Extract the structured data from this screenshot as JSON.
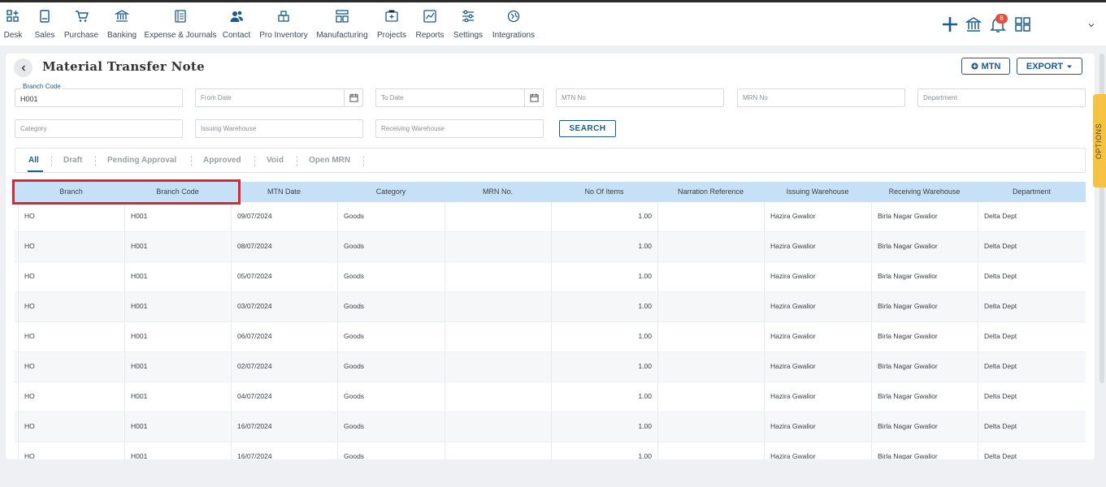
{
  "nav": [
    {
      "label": "Desk",
      "icon": "desk-icon"
    },
    {
      "label": "Sales",
      "icon": "sales-icon"
    },
    {
      "label": "Purchase",
      "icon": "purchase-icon"
    },
    {
      "label": "Banking",
      "icon": "bank-icon"
    },
    {
      "label": "Expense & Journals",
      "icon": "journal-icon"
    },
    {
      "label": "Contact",
      "icon": "contact-icon"
    },
    {
      "label": "Pro Inventory",
      "icon": "inventory-icon"
    },
    {
      "label": "Manufacturing",
      "icon": "manufacturing-icon"
    },
    {
      "label": "Projects",
      "icon": "projects-icon"
    },
    {
      "label": "Reports",
      "icon": "reports-icon"
    },
    {
      "label": "Settings",
      "icon": "settings-icon"
    },
    {
      "label": "Integrations",
      "icon": "integrations-icon"
    }
  ],
  "notification_count": "8",
  "accent": "#1a5b8f",
  "page": {
    "title": "Material Transfer Note",
    "mtn_button": "MTN",
    "export_button": "EXPORT"
  },
  "filters": {
    "branch_code_label": "Branch Code",
    "branch_code_value": "H001",
    "from_date": "From Date",
    "to_date": "To Date",
    "mtn_no": "MTN No",
    "mrn_no": "MRN No",
    "department": "Department",
    "category": "Category",
    "issuing_warehouse": "Issuing Warehouse",
    "receiving_warehouse": "Receiving Warehouse",
    "search_button": "SEARCH"
  },
  "tabs": [
    "All",
    "Draft",
    "Pending Approval",
    "Approved",
    "Void",
    "Open MRN"
  ],
  "table": {
    "columns": [
      "Branch",
      "Branch Code",
      "MTN Date",
      "Category",
      "MRN No.",
      "No Of Items",
      "Narration Reference",
      "Issuing Warehouse",
      "Receiving Warehouse",
      "Department"
    ],
    "rows": [
      [
        "HO",
        "H001",
        "09/07/2024",
        "Goods",
        "",
        "1.00",
        "",
        "Hazira Gwalior",
        "Birla Nagar Gwalior",
        "Delta Dept"
      ],
      [
        "HO",
        "H001",
        "08/07/2024",
        "Goods",
        "",
        "1.00",
        "",
        "Hazira Gwalior",
        "Birla Nagar Gwalior",
        "Delta Dept"
      ],
      [
        "HO",
        "H001",
        "05/07/2024",
        "Goods",
        "",
        "1.00",
        "",
        "Hazira Gwalior",
        "Birla Nagar Gwalior",
        "Delta Dept"
      ],
      [
        "HO",
        "H001",
        "03/07/2024",
        "Goods",
        "",
        "1.00",
        "",
        "Hazira Gwalior",
        "Birla Nagar Gwalior",
        "Delta Dept"
      ],
      [
        "HO",
        "H001",
        "06/07/2024",
        "Goods",
        "",
        "1.00",
        "",
        "Hazira Gwalior",
        "Birla Nagar Gwalior",
        "Delta Dept"
      ],
      [
        "HO",
        "H001",
        "02/07/2024",
        "Goods",
        "",
        "1.00",
        "",
        "Hazira Gwalior",
        "Birla Nagar Gwalior",
        "Delta Dept"
      ],
      [
        "HO",
        "H001",
        "04/07/2024",
        "Goods",
        "",
        "1.00",
        "",
        "Hazira Gwalior",
        "Birla Nagar Gwalior",
        "Delta Dept"
      ],
      [
        "HO",
        "H001",
        "16/07/2024",
        "Goods",
        "",
        "1.00",
        "",
        "Hazira Gwalior",
        "Birla Nagar Gwalior",
        "Delta Dept"
      ],
      [
        "HO",
        "H001",
        "16/07/2024",
        "Goods",
        "",
        "1.00",
        "",
        "Hazira Gwalior",
        "Birla Nagar Gwalior",
        "Delta Dept"
      ]
    ]
  },
  "options_label": "OPTIONS"
}
